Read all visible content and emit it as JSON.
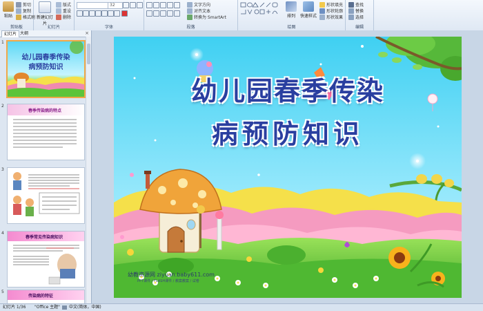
{
  "ribbon": {
    "clipboard": {
      "paste": "粘贴",
      "cut": "剪切",
      "copy": "复制",
      "format_painter": "格式刷",
      "label": "剪贴板"
    },
    "slides": {
      "new_slide": "新建幻灯片",
      "layout": "版式",
      "reset": "重设",
      "delete": "删除",
      "label": "幻灯片"
    },
    "font": {
      "size": "32",
      "label": "字体"
    },
    "paragraph": {
      "text_direction": "文字方向",
      "align_text": "对齐文本",
      "smartart": "转换为 SmartArt",
      "label": "段落"
    },
    "drawing": {
      "arrange": "排列",
      "quick_styles": "快速样式",
      "shape_fill": "形状填充",
      "shape_outline": "形状轮廓",
      "shape_effects": "形状效果",
      "label": "绘图"
    },
    "editing": {
      "find": "查找",
      "replace": "替换",
      "select": "选择",
      "label": "编辑"
    }
  },
  "panel": {
    "tab_slides": "幻灯片",
    "tab_outline": "大纲",
    "close": "×",
    "slide_numbers": [
      "1",
      "2",
      "3",
      "4",
      "5"
    ],
    "slide1_title_a": "幼儿园春季传染",
    "slide1_title_b": "病预防知识",
    "slide2_heading": "春季传染病的特点",
    "slide4_heading": "春季常见传染病知识",
    "slide5_heading": "传染病的特征"
  },
  "slide": {
    "title_line1": "幼儿园春季传染",
    "title_line2": "病预防知识",
    "watermark_site": "幼教资源网 ziyuan.baby611.com",
    "watermark_sub": "PPT课件 / FLASH课件 / 教案教案 / 试卷"
  },
  "status": {
    "slide_of": "幻灯片 1/36",
    "theme": "\"Office 主题\"",
    "language": "中文(简体，中国)"
  },
  "colors": {
    "title": "#2a3fa0",
    "sky_top": "#3fd0f2",
    "sky_bottom": "#b8f2ff",
    "grass": "#6bd13c",
    "selection": "#f0a848"
  }
}
